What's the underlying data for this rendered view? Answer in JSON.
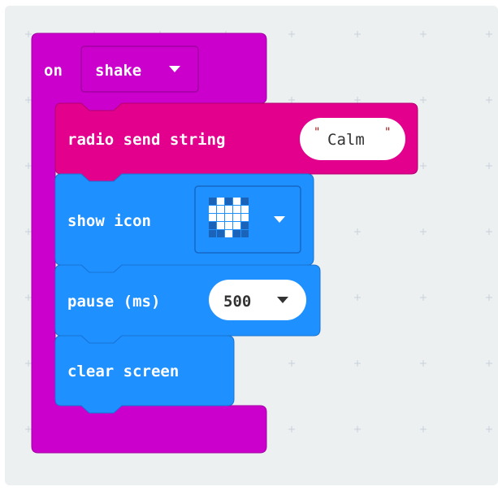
{
  "event_block": {
    "keyword": "on",
    "gesture": "shake",
    "color": "#cc00cc",
    "dropdown_icon": "triangle-down-icon"
  },
  "radio_block": {
    "label": "radio send string",
    "value": "Calm",
    "color": "#e3008c"
  },
  "show_icon_block": {
    "label": "show icon",
    "icon": "heart-led-icon",
    "color": "#1e90ff",
    "dropdown_icon": "triangle-down-icon"
  },
  "pause_block": {
    "label": "pause (ms)",
    "value": "500",
    "color": "#1e90ff",
    "dropdown_icon": "triangle-down-icon"
  },
  "clear_block": {
    "label": "clear screen",
    "color": "#1e90ff"
  },
  "workspace": {
    "background": "#ecf0f1",
    "grid_mark": "plus-icon"
  }
}
